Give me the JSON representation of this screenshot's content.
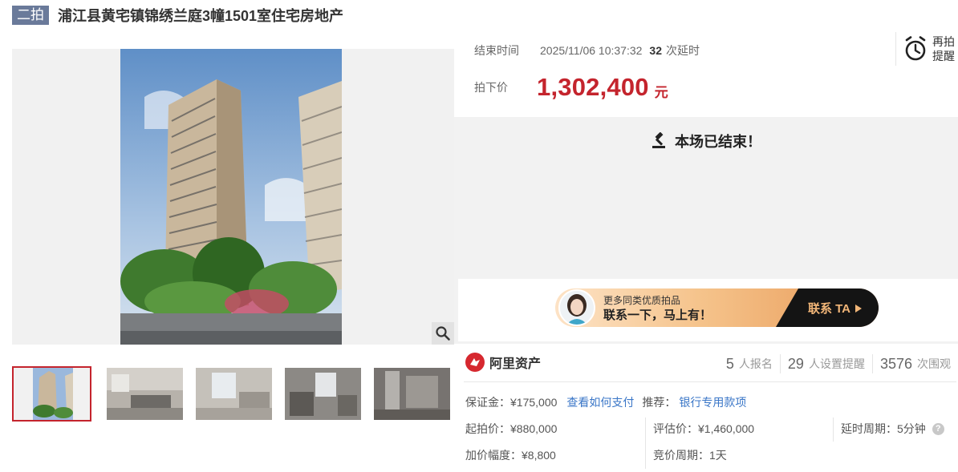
{
  "header": {
    "round_badge": "二拍",
    "title": "浦江县黄宅镇锦绣兰庭3幢1501室住宅房地产"
  },
  "auction": {
    "end_time_label": "结束时间",
    "end_time_value": "2025/11/06 10:37:32",
    "extension_count": "32",
    "extension_label": "次延时",
    "price_label": "拍下价",
    "price_value": "1,302,400",
    "price_unit": "元",
    "remind_label_line1": "再拍",
    "remind_label_line2": "提醒"
  },
  "ended": {
    "message": "本场已结束！"
  },
  "banner": {
    "line1": "更多同类优质拍品",
    "line2": "联系一下，马上有！",
    "cta": "联系 TA"
  },
  "platform": {
    "name": "阿里资产"
  },
  "stats": [
    {
      "num": "5",
      "label": "人报名"
    },
    {
      "num": "29",
      "label": "人设置提醒"
    },
    {
      "num": "3576",
      "label": "次围观"
    }
  ],
  "details": {
    "deposit": "保证金：¥175,000",
    "how_to_pay": "查看如何支付",
    "recommend_label": "推荐：",
    "recommend_link": "银行专用款项",
    "start_price": "起拍价：¥880,000",
    "appraisal": "评估价：¥1,460,000",
    "delay_period": "延时周期：5分钟",
    "increment": "加价幅度：¥8,800",
    "bid_period": "竞价周期：1天",
    "help_glyph": "?"
  },
  "icons": {
    "zoom": "magnifier-icon",
    "remind": "alarm-clock-icon",
    "ended": "gavel-icon",
    "platform": "ali-asset-logo-icon"
  },
  "colors": {
    "accent_red": "#c4242d",
    "link_blue": "#3a76c7",
    "badge_gray": "#6a7a9a"
  }
}
